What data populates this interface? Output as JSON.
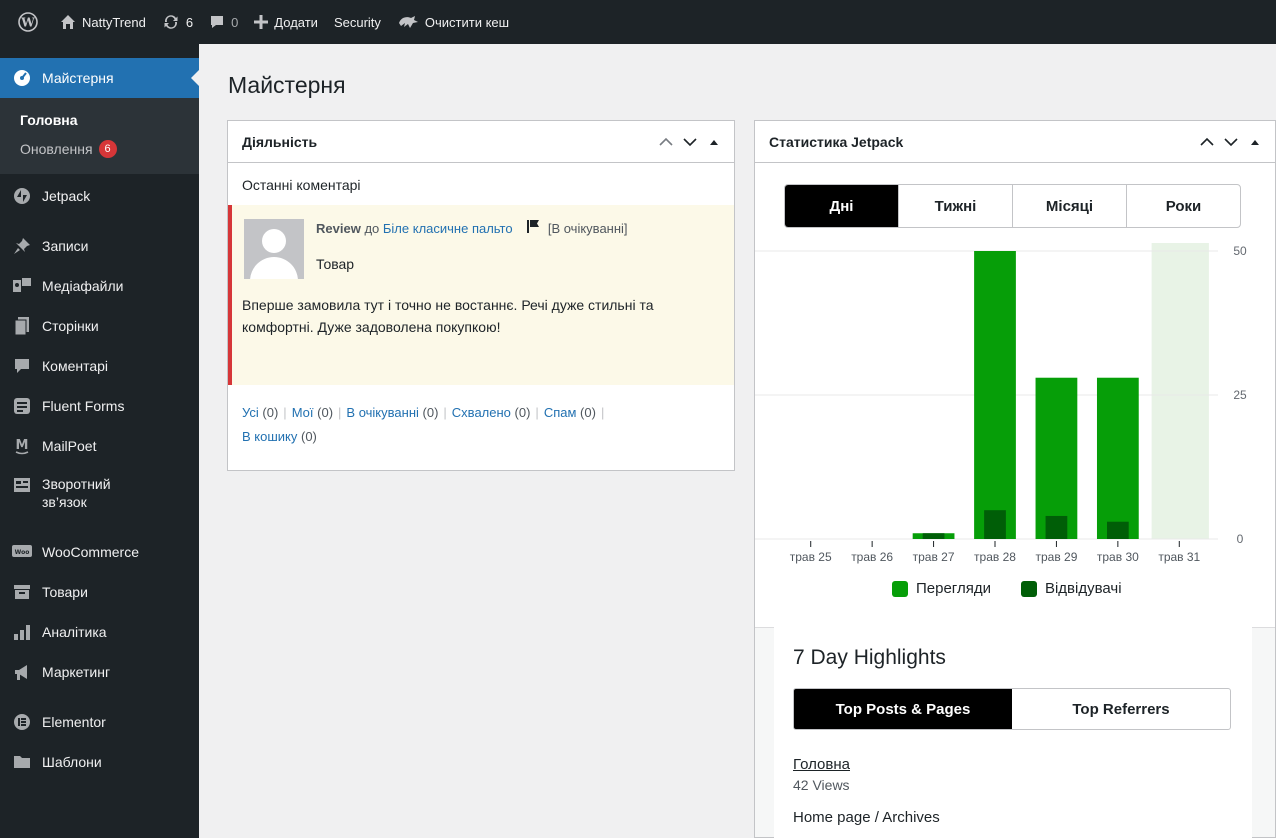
{
  "adminbar": {
    "site_name": "NattyTrend",
    "updates_count": "6",
    "comments_count": "0",
    "new_label": "Додати",
    "security_label": "Security",
    "cache_label": "Очистити кеш"
  },
  "sidebar": {
    "dashboard": "Майстерня",
    "sub_home": "Головна",
    "sub_updates": "Оновлення",
    "sub_updates_badge": "6",
    "items": [
      {
        "label": "Jetpack",
        "icon": "jetpack-icon"
      },
      {
        "label": "Записи",
        "icon": "pin-icon"
      },
      {
        "label": "Медіафайли",
        "icon": "media-icon"
      },
      {
        "label": "Сторінки",
        "icon": "page-icon"
      },
      {
        "label": "Коментарі",
        "icon": "comment-icon"
      },
      {
        "label": "Fluent Forms",
        "icon": "forms-icon"
      },
      {
        "label": "MailPoet",
        "icon": "mailpoet-icon"
      },
      {
        "label": "Зворотний зв’язок",
        "icon": "feedback-icon"
      },
      {
        "label": "WooCommerce",
        "icon": "woo-icon"
      },
      {
        "label": "Товари",
        "icon": "archive-icon"
      },
      {
        "label": "Аналітика",
        "icon": "chart-icon"
      },
      {
        "label": "Маркетинг",
        "icon": "megaphone-icon"
      },
      {
        "label": "Elementor",
        "icon": "elementor-icon"
      },
      {
        "label": "Шаблони",
        "icon": "folder-icon"
      }
    ]
  },
  "page_title": "Майстерня",
  "activity": {
    "title": "Діяльність",
    "subtitle": "Останні коментарі",
    "comment": {
      "author": "Review",
      "to": "до",
      "post_link": "Біле класичне пальто",
      "status": "[В очікуванні]",
      "type": "Товар",
      "text": "Вперше замовила тут і точно не востаннє. Речі дуже стильні та комфортні. Дуже задоволена покупкою!"
    },
    "filters": {
      "all": "Усі",
      "all_count": "(0)",
      "mine": "Мої",
      "mine_count": "(0)",
      "pending": "В очікуванні",
      "pending_count": "(0)",
      "approved": "Схвалено",
      "approved_count": "(0)",
      "spam": "Спам",
      "spam_count": "(0)",
      "trash": "В кошику",
      "trash_count": "(0)"
    }
  },
  "stats": {
    "title": "Статистика Jetpack",
    "periods": [
      "Дні",
      "Тижні",
      "Місяці",
      "Роки"
    ],
    "active_period": "Дні",
    "legend_views": "Перегляди",
    "legend_visitors": "Відвідувачі",
    "colors": {
      "views": "#069e08",
      "visitors": "#005e07",
      "highlight": "#e8f3e6"
    },
    "highlights": {
      "title": "7 Day Highlights",
      "tabs": [
        "Top Posts & Pages",
        "Top Referrers"
      ],
      "items": [
        {
          "title": "Головна",
          "views": "42 Views"
        },
        {
          "title": "Home page / Archives",
          "views": ""
        }
      ]
    }
  },
  "chart_data": {
    "type": "bar",
    "categories": [
      "трав 25",
      "трав 26",
      "трав 27",
      "трав 28",
      "трав 29",
      "трав 30",
      "трав 31"
    ],
    "series": [
      {
        "name": "Перегляди",
        "values": [
          0,
          0,
          1,
          50,
          28,
          28,
          0
        ]
      },
      {
        "name": "Відвідувачі",
        "values": [
          0,
          0,
          1,
          5,
          4,
          3,
          0
        ]
      }
    ],
    "ylim": [
      0,
      50
    ],
    "yticks": [
      "0",
      "25",
      "50"
    ],
    "highlight_category": "трав 31",
    "grid": true,
    "legend": "bottom"
  }
}
